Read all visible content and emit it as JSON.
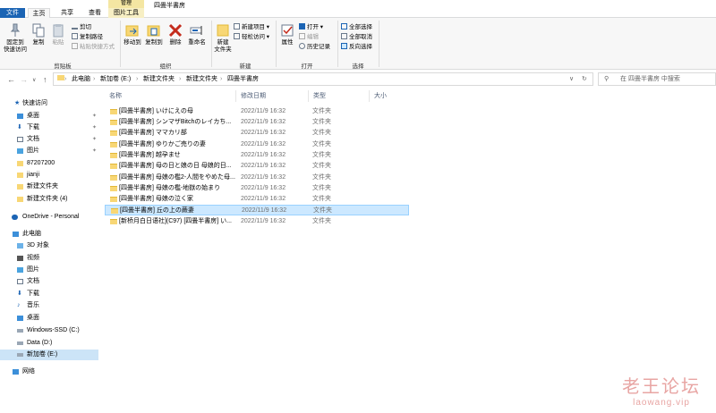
{
  "window": {
    "title": "四畳半書房",
    "context_header": "管理"
  },
  "tabs": {
    "file": "文件",
    "home": "主页",
    "share": "共享",
    "view": "查看",
    "picture_tools": "图片工具"
  },
  "ribbon": {
    "clipboard": {
      "pin": "固定到\n快速访问",
      "copy": "复制",
      "paste": "粘贴",
      "cut": "剪切",
      "copy_path": "复制路径",
      "paste_shortcut": "粘贴快捷方式",
      "label": "剪贴板"
    },
    "organize": {
      "move_to": "移动到",
      "copy_to": "复制到",
      "delete": "删除",
      "rename": "重命名",
      "label": "组织"
    },
    "new": {
      "new_folder": "新建\n文件夹",
      "new_item": "新建项目",
      "easy_access": "轻松访问",
      "label": "新建"
    },
    "open": {
      "properties": "属性",
      "open": "打开",
      "edit": "编辑",
      "history": "历史记录",
      "label": "打开"
    },
    "select": {
      "select_all": "全部选择",
      "select_none": "全部取消",
      "invert": "反向选择",
      "label": "选择"
    }
  },
  "address": {
    "crumbs": [
      "此电脑",
      "新加卷 (E:)",
      "新建文件夹",
      "新建文件夹",
      "四畳半書房"
    ],
    "search_placeholder": "在 四畳半書房 中搜索"
  },
  "nav": {
    "quick_access": "快速访问",
    "items": [
      "桌面",
      "下载",
      "文档",
      "图片",
      "87207200",
      "jianji",
      "新建文件夹",
      "新建文件夹 (4)"
    ],
    "onedrive": "OneDrive - Personal",
    "this_pc": "此电脑",
    "pc_items": [
      "3D 对象",
      "视频",
      "图片",
      "文档",
      "下载",
      "音乐",
      "桌面",
      "Windows-SSD (C:)",
      "Data (D:)",
      "新加卷 (E:)"
    ],
    "network": "网络"
  },
  "columns": {
    "name": "名称",
    "date": "修改日期",
    "type": "类型",
    "size": "大小"
  },
  "files": [
    {
      "name": "[四畳半書房] いけにえの母",
      "date": "2022/11/9 16:32",
      "type": "文件夹"
    },
    {
      "name": "[四畳半書房] シンマザBitchのレイカち...",
      "date": "2022/11/9 16:32",
      "type": "文件夹"
    },
    {
      "name": "[四畳半書房] ママカリ部",
      "date": "2022/11/9 16:32",
      "type": "文件夹"
    },
    {
      "name": "[四畳半書房] ゆりかご売りの妻",
      "date": "2022/11/9 16:32",
      "type": "文件夹"
    },
    {
      "name": "[四畳半書房] 越孕ませ",
      "date": "2022/11/9 16:32",
      "type": "文件夹"
    },
    {
      "name": "[四畳半書房] 母の日と娘の日 母娘的日...",
      "date": "2022/11/9 16:32",
      "type": "文件夹"
    },
    {
      "name": "[四畳半書房] 母娘の檻2-人間をやめた母...",
      "date": "2022/11/9 16:32",
      "type": "文件夹"
    },
    {
      "name": "[四畳半書房] 母娘の檻-地獄の始まり",
      "date": "2022/11/9 16:32",
      "type": "文件夹"
    },
    {
      "name": "[四畳半書房] 母娘の泣く家",
      "date": "2022/11/9 16:32",
      "type": "文件夹"
    },
    {
      "name": "[四畳半書房] 丘の上の蕨妻",
      "date": "2022/11/9 16:32",
      "type": "文件夹"
    },
    {
      "name": "[新桥月白日语社](C97) [四畳半書房] い...",
      "date": "2022/11/9 16:32",
      "type": "文件夹"
    }
  ],
  "watermark": {
    "line1": "老王论坛",
    "line2": "laowang.vip"
  },
  "colors": {
    "accent": "#1b64b4",
    "selection": "#cce8ff",
    "folder": "#f8d775"
  }
}
